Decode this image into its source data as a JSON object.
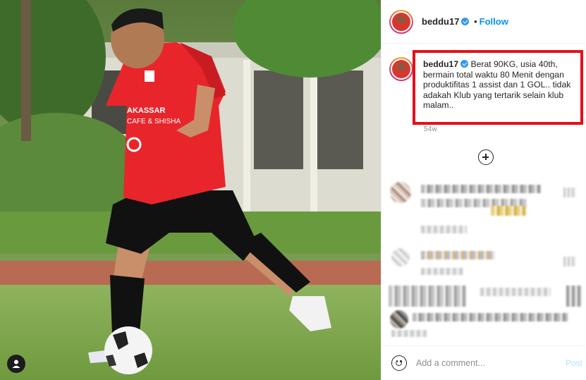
{
  "header": {
    "username": "beddu17",
    "separator": "•",
    "follow_label": "Follow"
  },
  "caption": {
    "username": "beddu17",
    "text": "Berat 90KG, usia 40th, bermain total waktu 80 Menit dengan produktifitas 1 assist dan 1 GOL.. tidak adakah Klub yang tertarik selain klub malam..",
    "time": "54w"
  },
  "comments": {
    "load_more_icon": "plus-circle-icon",
    "censored": true
  },
  "footer": {
    "emoji_icon": "emoji-icon",
    "comment_placeholder": "Add a comment...",
    "post_label": "Post"
  },
  "photo": {
    "user_tag_icon": "user-icon",
    "jersey_color": "#e8252b",
    "highlight_color": "#e3101a"
  }
}
